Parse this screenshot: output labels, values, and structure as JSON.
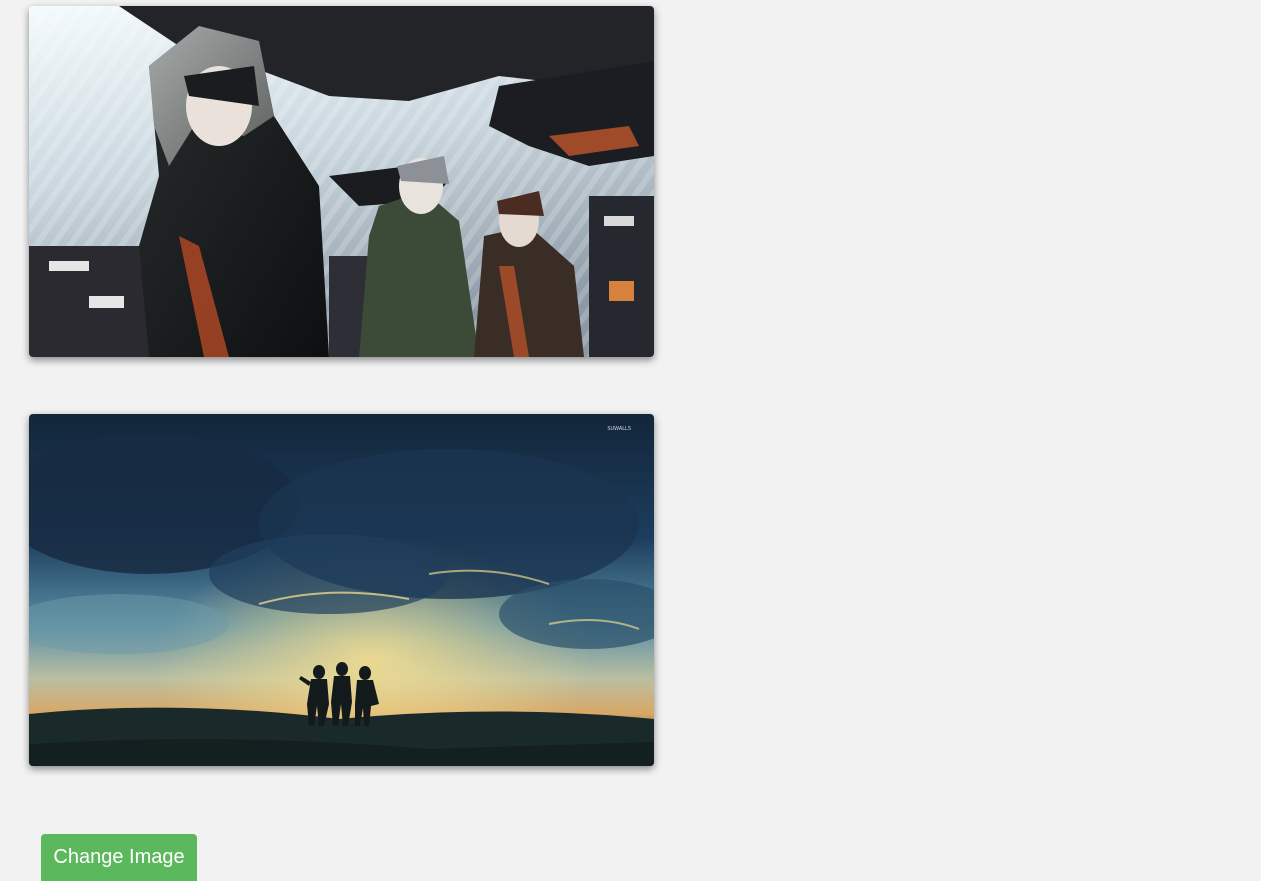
{
  "images": [
    {
      "label": "hooded trio anime artwork"
    },
    {
      "label": "three silhouettes at sunset anime artwork",
      "watermark": "SUWALLS"
    }
  ],
  "actions": {
    "change_image_label": "Change Image",
    "button_color": "#5cb85c",
    "page_background": "#f2f2f2"
  }
}
